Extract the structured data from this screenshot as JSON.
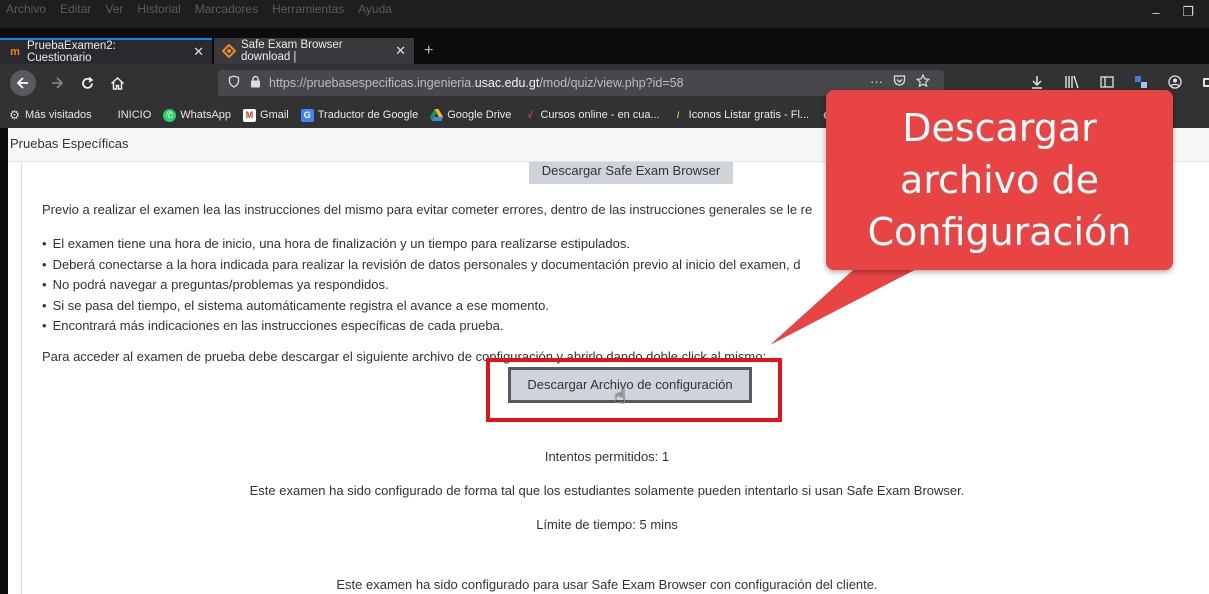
{
  "window": {
    "menu": [
      "Archivo",
      "Editar",
      "Ver",
      "Historial",
      "Marcadores",
      "Herramientas",
      "Ayuda"
    ],
    "minimize": "–",
    "restore": "❐"
  },
  "tabs": [
    {
      "title": "PruebaExamen2: Cuestionario",
      "close": "✕"
    },
    {
      "title": "Safe Exam Browser download |",
      "close": "✕"
    }
  ],
  "newtab": "+",
  "navbar": {
    "url_prefix": "https://pruebasespecificas.ingenieria.",
    "url_domain": "usac.edu.gt",
    "url_suffix": "/mod/quiz/view.php?id=58",
    "more": "···"
  },
  "bookmarks": [
    {
      "label": "Más visitados",
      "icon": "gear-icon"
    },
    {
      "label": "INICIO",
      "icon": "none"
    },
    {
      "label": "WhatsApp",
      "icon": "whatsapp-icon"
    },
    {
      "label": "Gmail",
      "icon": "gmail-icon"
    },
    {
      "label": "Traductor de Google",
      "icon": "translate-icon"
    },
    {
      "label": "Google Drive",
      "icon": "drive-icon"
    },
    {
      "label": "Cursos online - en cua...",
      "icon": "cursos-icon"
    },
    {
      "label": "Iconos Listar gratis - Fl...",
      "icon": "flaticon-icon"
    }
  ],
  "page": {
    "header": "Pruebas Específicas",
    "seb_button": "Descargar Safe Exam Browser",
    "intro": "Previo a realizar el examen lea las instrucciones del mismo para evitar cometer errores, dentro de las instrucciones generales se le re",
    "bullets": [
      "El examen tiene una hora de inicio, una hora de finalización y un tiempo para realizarse estipulados.",
      "Deberá conectarse a la hora indicada para realizar la revisión de datos personales y documentación previo al inicio del examen, d",
      "No podrá navegar a preguntas/problemas ya respondidos.",
      "Si se pasa del tiempo, el sistema automáticamente registra el avance a ese momento.",
      "Encontrará más indicaciones en las instrucciones específicas de cada prueba."
    ],
    "access_text": "Para acceder al examen de prueba debe descargar el siguiente archivo de configuración y abrirlo dando doble click al mismo:",
    "config_button": "Descargar Archivo de configuración",
    "attempts": "Intentos permitidos: 1",
    "seb_note": "Este examen ha sido configurado de forma tal que los estudiantes solamente pueden intentarlo si usan Safe Exam Browser.",
    "time_limit": "Límite de tiempo: 5 mins",
    "client_config": "Este examen ha sido configurado para usar Safe Exam Browser con configuración del cliente."
  },
  "callout": {
    "lines": [
      "Descargar",
      "archivo de",
      "Configuración"
    ],
    "color": "#e84444"
  }
}
